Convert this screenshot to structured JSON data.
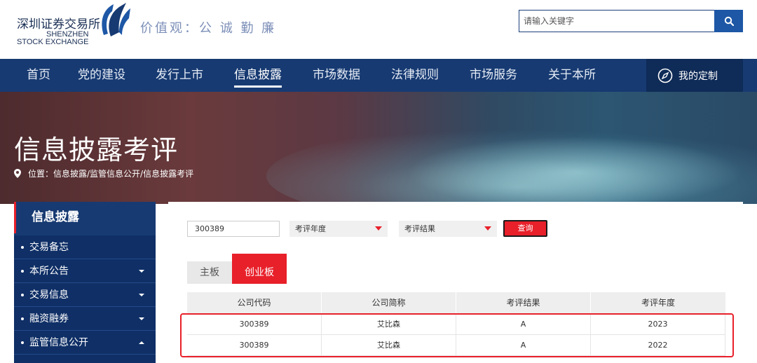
{
  "header": {
    "logo_cn": "深圳证券交易所",
    "logo_en_line1": "SHENZHEN",
    "logo_en_line2": "STOCK EXCHANGE",
    "slogan": "价值观：公 诚 勤 廉",
    "search_placeholder": "请输入关键字"
  },
  "nav": {
    "items": [
      {
        "label": "首页"
      },
      {
        "label": "党的建设"
      },
      {
        "label": "发行上市"
      },
      {
        "label": "信息披露",
        "active": true
      },
      {
        "label": "市场数据"
      },
      {
        "label": "法律规则"
      },
      {
        "label": "市场服务"
      },
      {
        "label": "关于本所"
      }
    ],
    "custom_label": "我的定制"
  },
  "banner": {
    "title": "信息披露考评",
    "breadcrumb": "位置：信息披露/监管信息公开/信息披露考评"
  },
  "sidebar": {
    "heading": "信息披露",
    "items": [
      {
        "label": "交易备忘",
        "arrow": "none"
      },
      {
        "label": "本所公告",
        "arrow": "down"
      },
      {
        "label": "交易信息",
        "arrow": "down"
      },
      {
        "label": "融资融券",
        "arrow": "down"
      },
      {
        "label": "监管信息公开",
        "arrow": "up"
      }
    ]
  },
  "filters": {
    "code_value": "300389",
    "year_select": "考评年度",
    "result_select": "考评结果",
    "query_label": "查询"
  },
  "tabs": [
    {
      "label": "主板",
      "active": false
    },
    {
      "label": "创业板",
      "active": true
    }
  ],
  "table": {
    "headers": [
      "公司代码",
      "公司简称",
      "考评结果",
      "考评年度"
    ],
    "rows": [
      [
        "300389",
        "艾比森",
        "A",
        "2023"
      ],
      [
        "300389",
        "艾比森",
        "A",
        "2022"
      ]
    ]
  },
  "colors": {
    "nav_bg": "#173a72",
    "accent_red": "#e8202a",
    "search_blue": "#1d57a6"
  }
}
